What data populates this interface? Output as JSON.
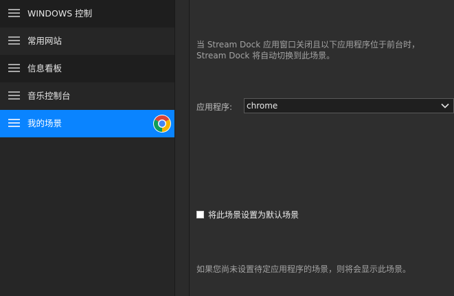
{
  "sidebar": {
    "items": [
      {
        "label": "WINDOWS 控制"
      },
      {
        "label": "常用网站"
      },
      {
        "label": "信息看板"
      },
      {
        "label": "音乐控制台"
      },
      {
        "label": "我的场景",
        "selected": true,
        "icon": "chrome-icon"
      }
    ]
  },
  "settings": {
    "description": "当 Stream Dock 应用窗口关闭且以下应用程序位于前台时，Stream Dock 将自动切换到此场景。",
    "app_label": "应用程序:",
    "app_value": "chrome",
    "default_checkbox_label": "将此场景设置为默认场景",
    "default_checked": false,
    "hint": "如果您尚未设置待定应用程序的场景，则将会显示此场景。"
  },
  "colors": {
    "accent": "#0a84ff",
    "sidebar_bg": "#262626",
    "pane_bg": "#2e2e2e"
  }
}
